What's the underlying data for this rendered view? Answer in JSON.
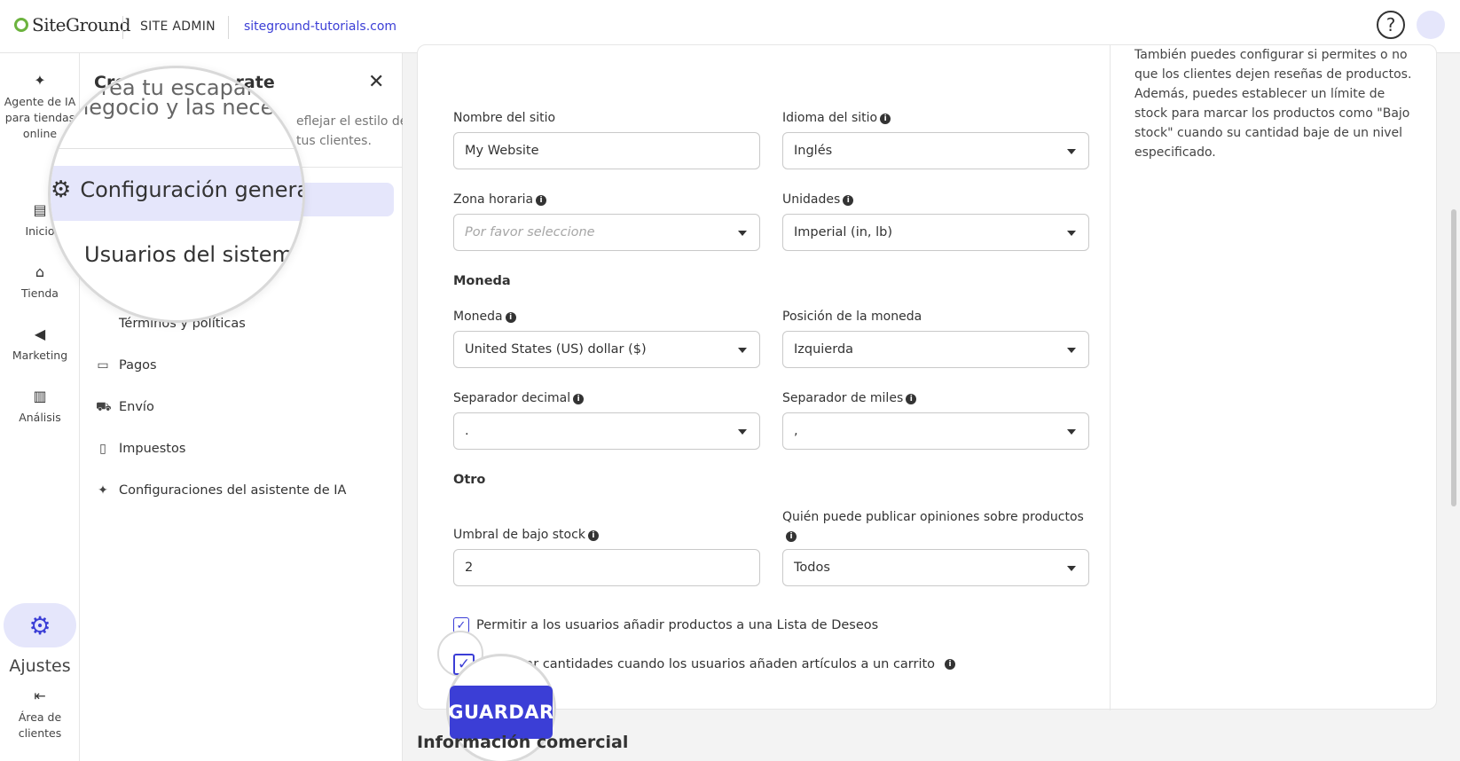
{
  "header": {
    "logo_text": "SiteGround",
    "site_admin": "SITE ADMIN",
    "domain": "siteground-tutorials.com",
    "help_icon": "question-circle-icon"
  },
  "rail": {
    "items": [
      {
        "label": "Agente de IA para tiendas online",
        "icon": "sparkle-icon"
      },
      {
        "label": "Inicio",
        "icon": "dashboard-icon"
      },
      {
        "label": "Tienda",
        "icon": "store-icon"
      },
      {
        "label": "Marketing",
        "icon": "megaphone-icon"
      },
      {
        "label": "Análisis",
        "icon": "chart-icon"
      },
      {
        "label": "Ajustes",
        "icon": "gear-icon"
      },
      {
        "label": "Área de clientes",
        "icon": "exit-icon"
      }
    ]
  },
  "submenu": {
    "title": "Crea tu escaparate",
    "desc_line1": "negocio y las necesidades",
    "desc_partial1": "eflejar el estilo de",
    "desc_partial2": "tus clientes.",
    "items": [
      {
        "label": "Configuración general",
        "icon": "gear-icon"
      },
      {
        "label": "Usuarios del sistema",
        "icon": "users-icon"
      },
      {
        "label": "Términos y políticas",
        "icon": "document-icon"
      },
      {
        "label": "Pagos",
        "icon": "credit-card-icon"
      },
      {
        "label": "Envío",
        "icon": "truck-icon"
      },
      {
        "label": "Impuestos",
        "icon": "tax-icon"
      },
      {
        "label": "Configuraciones del asistente de IA",
        "icon": "sparkle-icon"
      }
    ],
    "magnifier": {
      "line1": "Crea tu escaparate",
      "line2": "negocio y las necesidades"
    }
  },
  "form": {
    "site_name_label": "Nombre del sitio",
    "site_name_value": "My Website",
    "language_label": "Idioma del sitio",
    "language_value": "Inglés",
    "timezone_label": "Zona horaria",
    "timezone_placeholder": "Por favor seleccione",
    "units_label": "Unidades",
    "units_value": "Imperial (in, lb)",
    "currency_section": "Moneda",
    "currency_label": "Moneda",
    "currency_value": "United States (US) dollar ($)",
    "currency_pos_label": "Posición de la moneda",
    "currency_pos_value": "Izquierda",
    "decimal_sep_label": "Separador decimal",
    "decimal_sep_value": ".",
    "thousand_sep_label": "Separador de miles",
    "thousand_sep_value": ",",
    "other_section": "Otro",
    "low_stock_label": "Umbral de bajo stock",
    "low_stock_value": "2",
    "reviews_label": "Quién puede publicar opiniones sobre productos",
    "reviews_value": "Todos",
    "wishlist_label": "Permitir a los usuarios añadir productos a una Lista de Deseos",
    "reserve_label": "Reservar cantidades cuando los usuarios añaden artículos a un carrito",
    "save_label": "GUARDAR"
  },
  "help_text": "También puedes configurar si permites o no que los clientes dejen reseñas de productos. Además, puedes establecer un límite de stock para marcar los productos como \"Bajo stock\" cuando su cantidad baje de un nivel especificado.",
  "next_section_title": "Información comercial",
  "colors": {
    "accent": "#3b3ed6",
    "accent_light": "#e5e6fb",
    "logo_green": "#6cb33e"
  }
}
